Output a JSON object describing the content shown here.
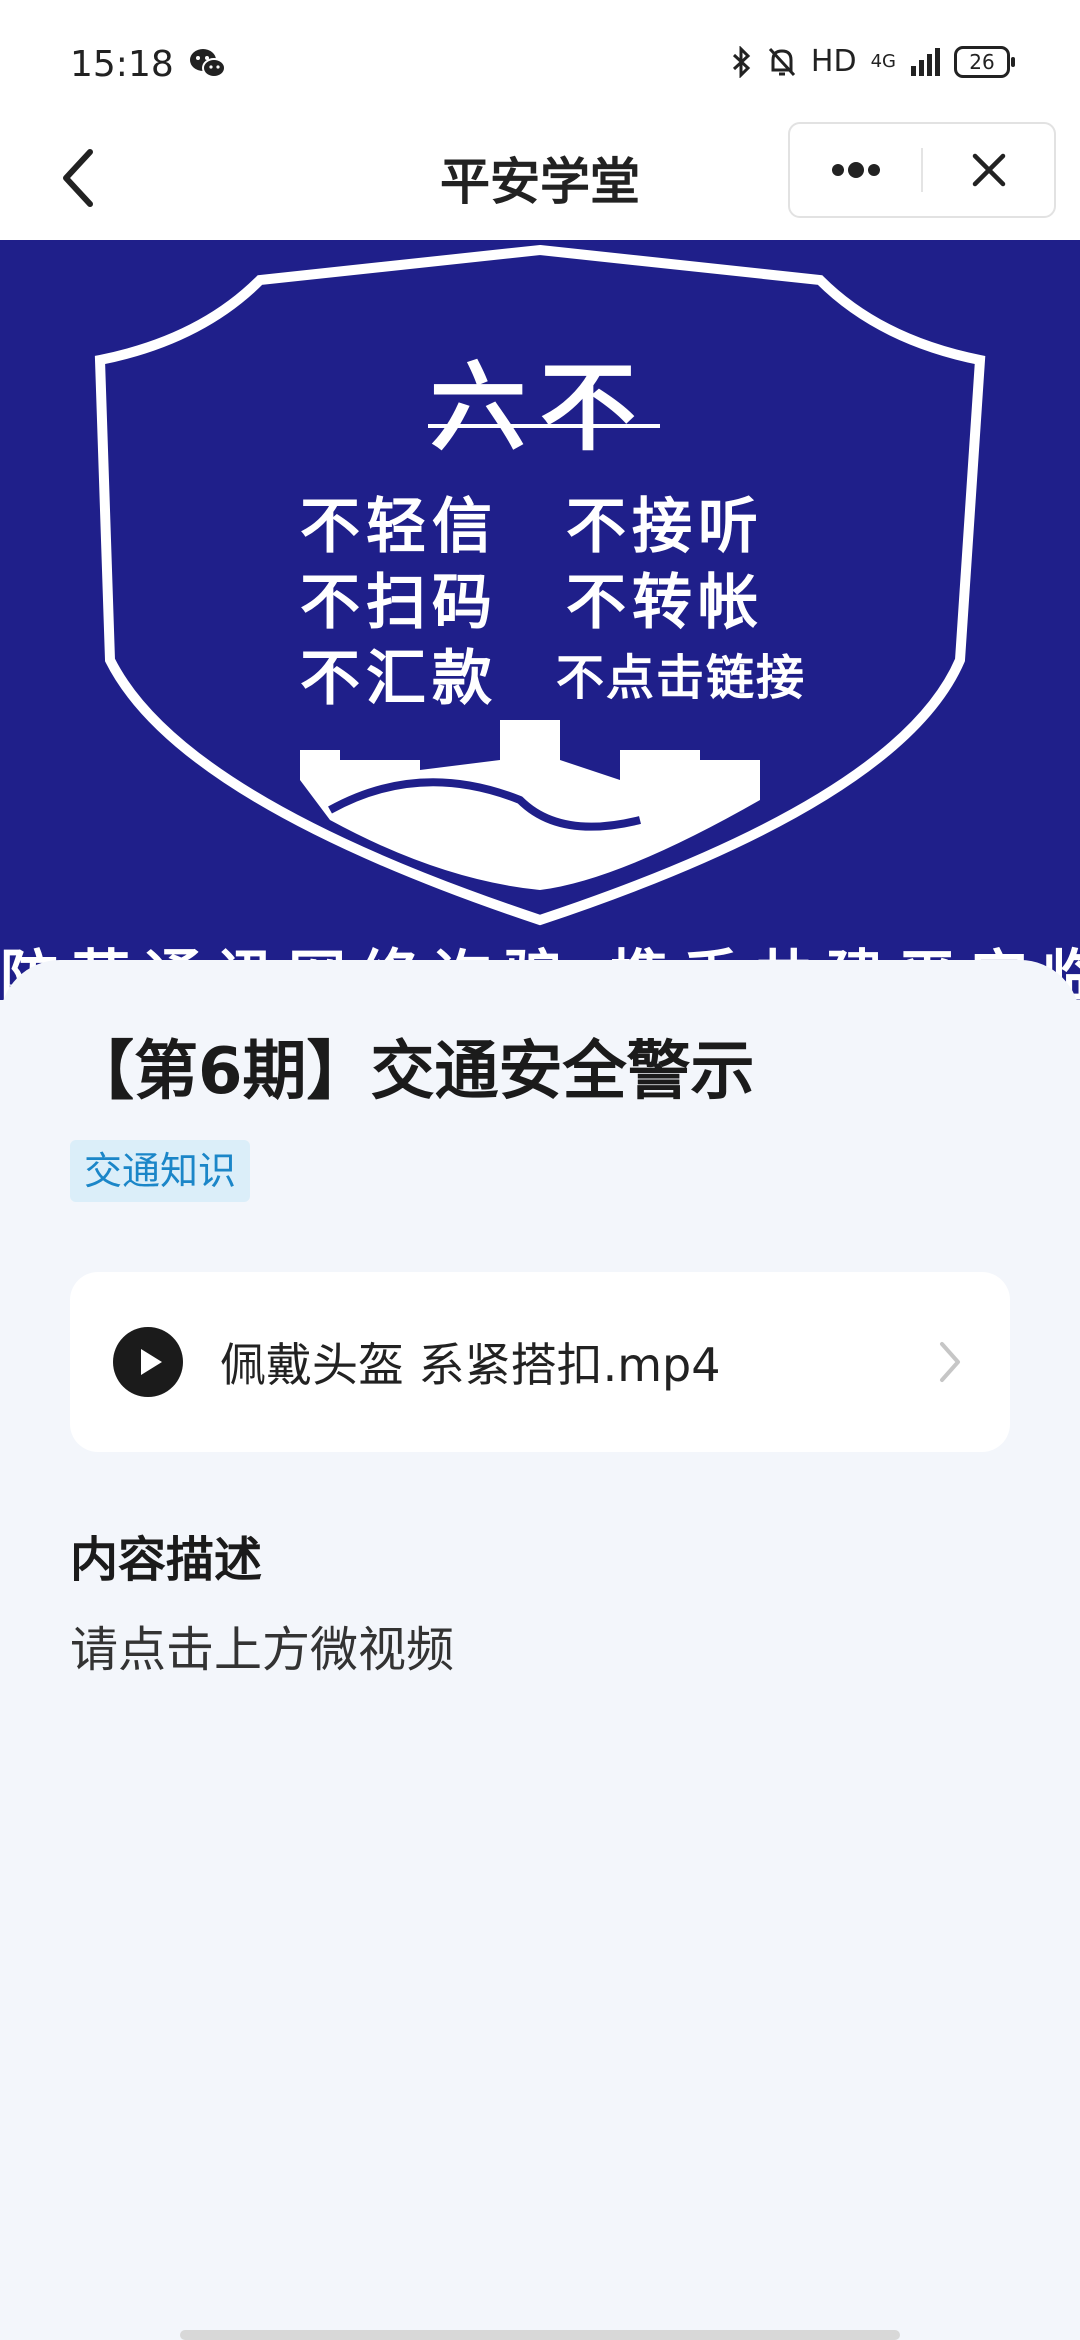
{
  "status_bar": {
    "time": "15:18",
    "hd_label": "HD",
    "network_label": "4G",
    "battery_level": "26",
    "icons": [
      "wechat-icon",
      "bluetooth-icon",
      "bell-muted-icon",
      "signal-icon",
      "battery-icon"
    ]
  },
  "nav": {
    "title": "平安学堂",
    "back_icon": "chevron-left-icon",
    "more_icon": "more-dots-icon",
    "close_icon": "close-icon"
  },
  "banner": {
    "title": "六不",
    "rules": [
      "不轻信",
      "不接听",
      "不扫码",
      "不转帐",
      "不汇款",
      "不点击链接"
    ],
    "slogan": "防范通讯网络诈骗  携手共建平安临沭",
    "colors": {
      "background": "#1f1f8a",
      "foreground": "#ffffff"
    }
  },
  "article": {
    "title": "【第6期】交通安全警示",
    "tag": "交通知识",
    "video": {
      "name": "佩戴头盔 系紧搭扣.mp4",
      "icon": "play-icon"
    },
    "description_label": "内容描述",
    "description_text": "请点击上方微视频"
  },
  "colors": {
    "accent": "#1b86c8",
    "tag_background": "#dbeef9",
    "page_background": "#f3f6fb"
  }
}
